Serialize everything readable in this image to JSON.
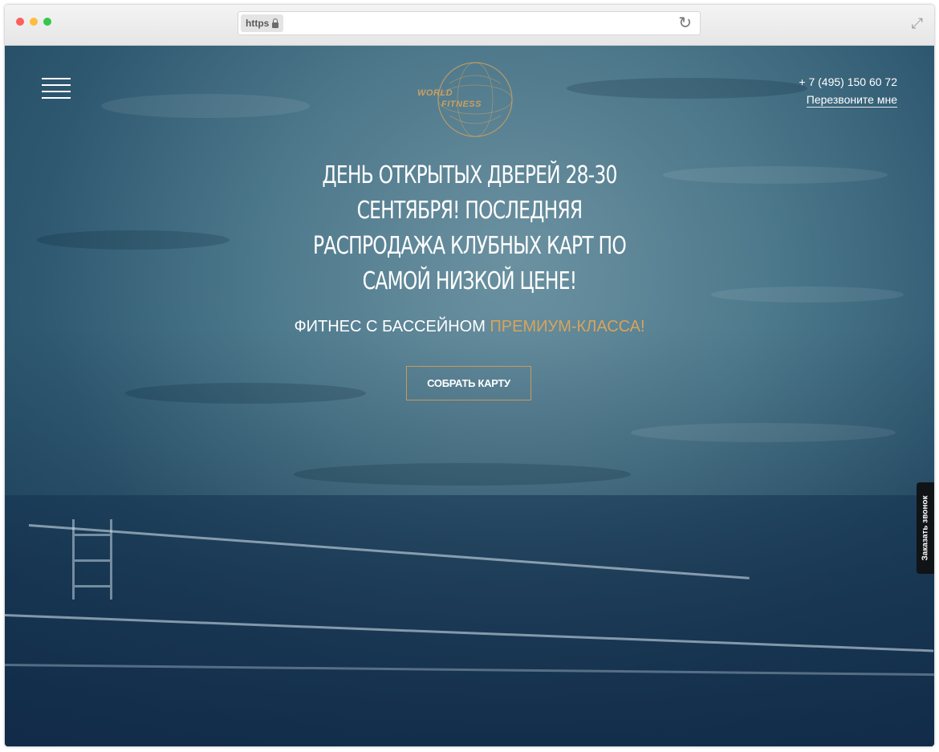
{
  "browser": {
    "url_scheme": "https",
    "reload_icon": "reload-icon",
    "expand_icon": "expand-icon"
  },
  "header": {
    "menu_icon": "hamburger-menu-icon",
    "logo": {
      "line1": "WORLD",
      "line2": "FITNESS"
    },
    "phone": "+ 7 (495) 150 60 72",
    "callback_label": "Перезвоните мне"
  },
  "hero": {
    "title": "ДЕНЬ ОТКРЫТЫХ ДВЕРЕЙ 28-30 СЕНТЯБРЯ! ПОСЛЕДНЯЯ РАСПРОДАЖА КЛУБНЫХ КАРТ ПО САМОЙ НИЗКОЙ ЦЕНЕ!",
    "subtitle_plain": "ФИТНЕС С БАССЕЙНОМ ",
    "subtitle_accent": "ПРЕМИУМ-КЛАССА!",
    "cta_label": "СОБРАТЬ КАРТУ"
  },
  "side_tab": {
    "label": "Заказать звонок"
  },
  "colors": {
    "accent_gold": "#d7a45c",
    "button_border": "#c9995a",
    "text_white": "#ffffff",
    "side_tab_bg": "#101416"
  }
}
